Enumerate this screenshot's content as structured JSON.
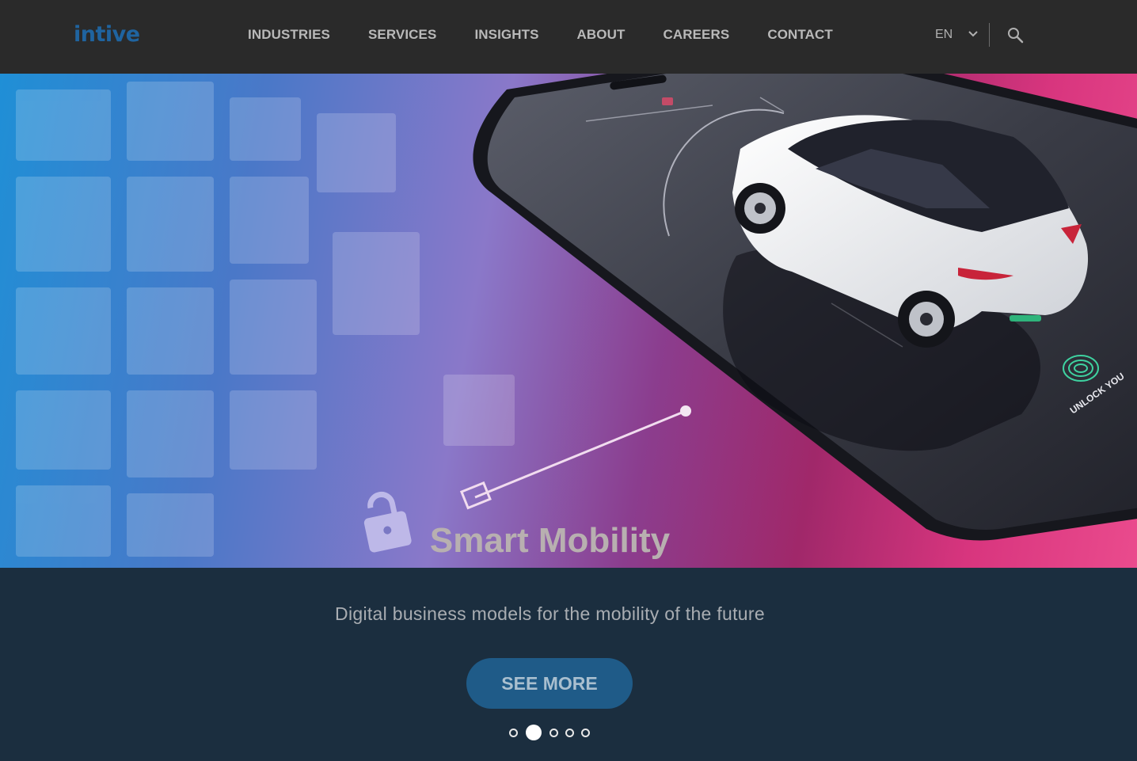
{
  "header": {
    "logo": "intive",
    "nav": [
      "INDUSTRIES",
      "SERVICES",
      "INSIGHTS",
      "ABOUT",
      "CAREERS",
      "CONTACT"
    ],
    "language": "EN",
    "icons": [
      "chevron-down-icon",
      "search-icon"
    ]
  },
  "hero": {
    "title": "Smart Mobility",
    "phone_text": "UNLOCK YOU"
  },
  "band": {
    "subtitle": "Digital business models for the mobility of the future",
    "cta": "SEE MORE"
  },
  "carousel": {
    "slide_count": 5,
    "active_index": 1
  },
  "colors": {
    "header_bg": "#2a2a2a",
    "logo": "#1f64a0",
    "band_bg": "#1b2e3f",
    "button_bg": "#1f5b88"
  }
}
